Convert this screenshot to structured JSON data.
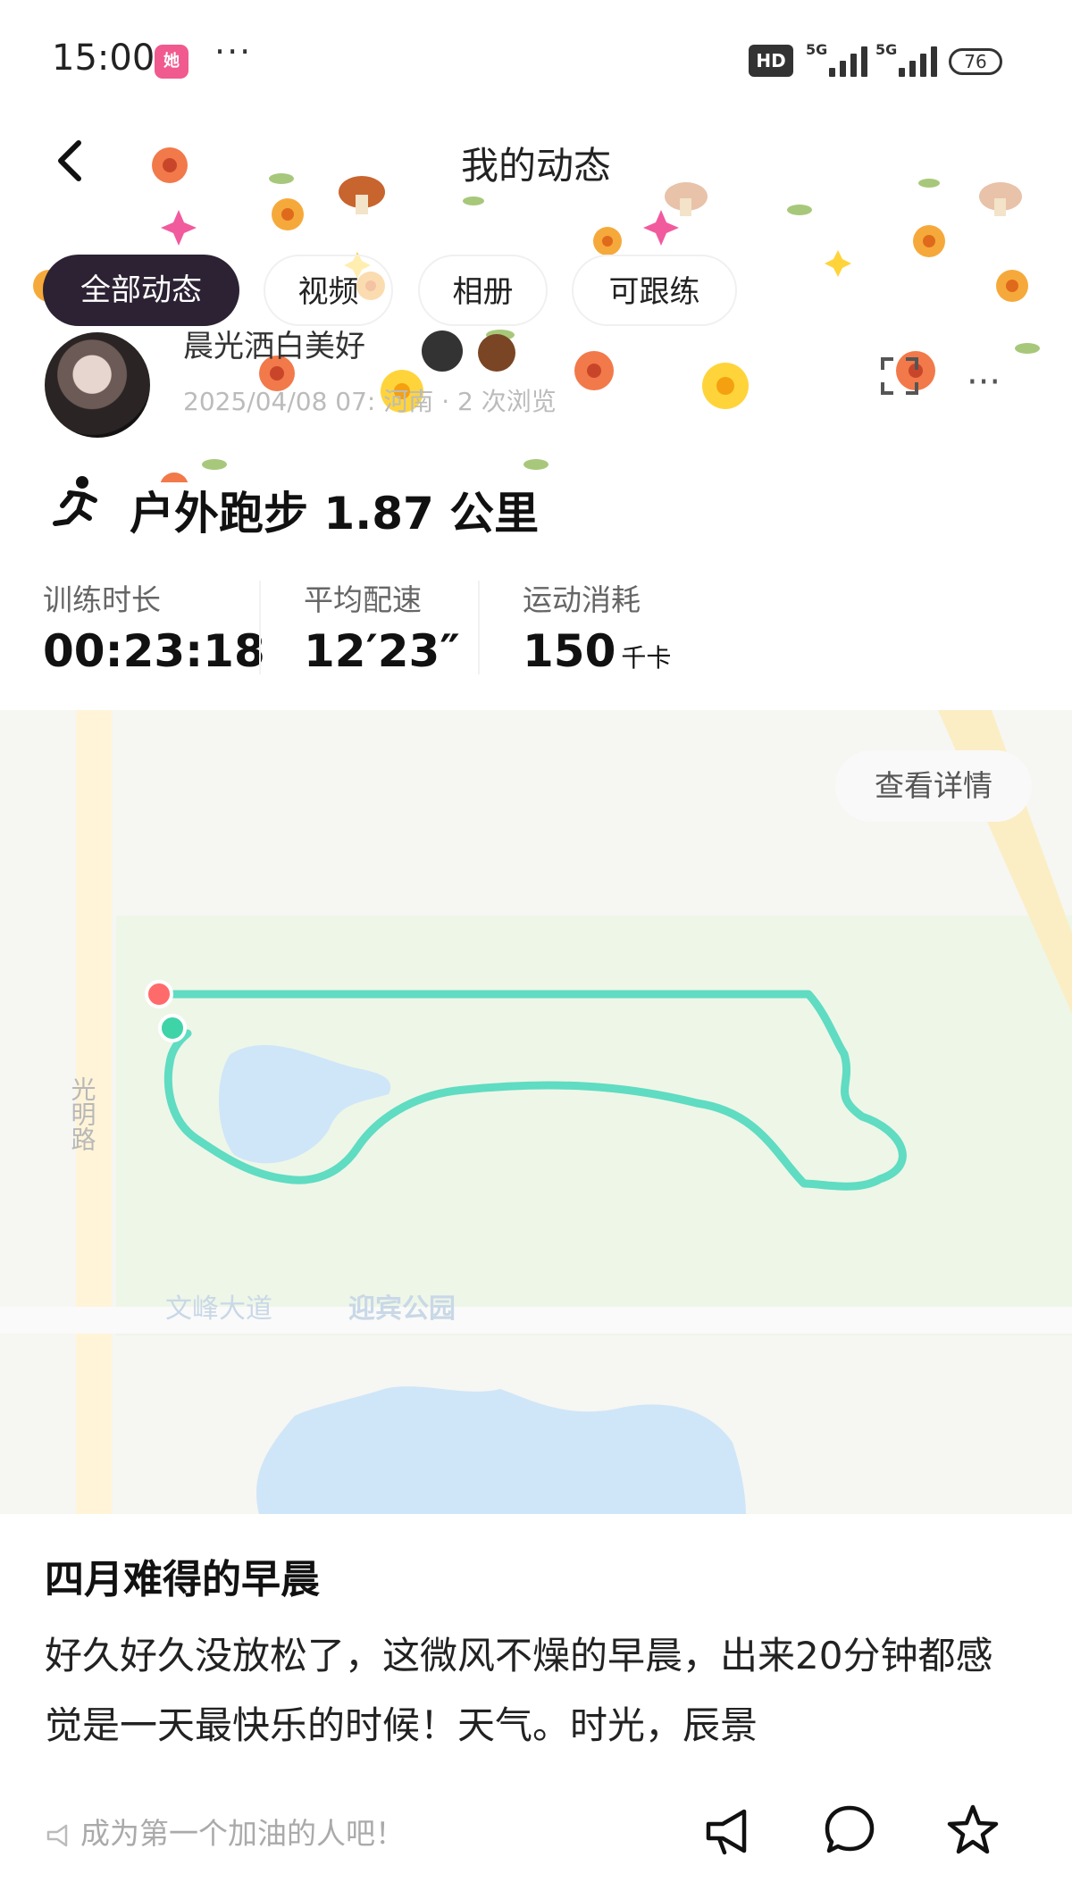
{
  "status_bar": {
    "time": "15:00",
    "app_badge": "她",
    "more": "···",
    "hd": "HD",
    "network_1": "5G",
    "network_2": "5G",
    "battery": "76"
  },
  "header": {
    "title": "我的动态"
  },
  "tabs": [
    {
      "label": "全部动态",
      "active": true
    },
    {
      "label": "视频",
      "active": false
    },
    {
      "label": "相册",
      "active": false
    },
    {
      "label": "可跟练",
      "active": false
    }
  ],
  "post": {
    "username": "晨光洒白美好",
    "date": "2025/04/08 07:",
    "location": "河南",
    "views": "2 次浏览",
    "run_summary": "户外跑步 1.87 公里",
    "stats": [
      {
        "label": "训练时长",
        "value": "00:23:18",
        "unit": ""
      },
      {
        "label": "平均配速",
        "value": "12′23″",
        "unit": ""
      },
      {
        "label": "运动消耗",
        "value": "150",
        "unit": "千卡"
      }
    ],
    "map": {
      "view_details": "查看详情",
      "road_vertical": "光明路",
      "road_horizontal": "文峰大道",
      "park": "迎宾公园"
    },
    "title": "四月难得的早晨",
    "body": "好久好久没放松了，这微风不燥的早晨，出来20分钟都感觉是一天最快乐的时候！天气。时光，辰景"
  },
  "footer": {
    "cheer_hint": "成为第一个加油的人吧！"
  },
  "colors": {
    "accent_dark": "#2c2233",
    "route": "#5fdcc2",
    "start_dot": "#ff6b6b",
    "end_dot": "#3fd3a8",
    "water": "#cfe6f8"
  }
}
